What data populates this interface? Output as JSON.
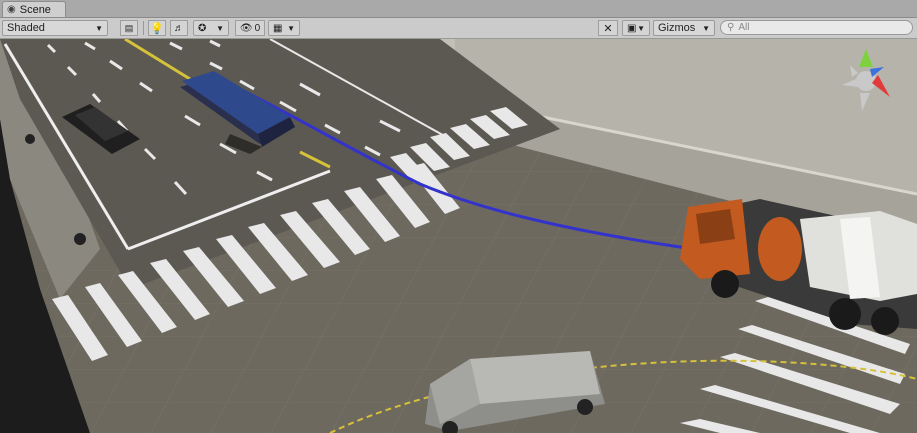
{
  "tab": {
    "label": "Scene",
    "icon": "scene-icon"
  },
  "toolbar": {
    "shading_mode": "Shaded",
    "gizmo_count": "0",
    "gizmos_label": "Gizmos",
    "search_placeholder": "All"
  },
  "icons": {
    "draw_mode_2d": "2d-toggle-icon",
    "lighting": "lightbulb-icon",
    "audio": "audio-icon",
    "effects": "effects-icon",
    "hidden_objects": "visibility-icon",
    "grid": "grid-icon",
    "tools": "tools-icon",
    "camera": "camera-icon",
    "search": "search-icon"
  },
  "colors": {
    "path_line": "#3333cc",
    "ground": "#6e6a60",
    "lane_marking": "#ffffff",
    "center_line": "#d6c13a",
    "gizmo_x": "#e03a3a",
    "gizmo_y": "#7ed23f",
    "gizmo_z": "#3a72e0"
  }
}
